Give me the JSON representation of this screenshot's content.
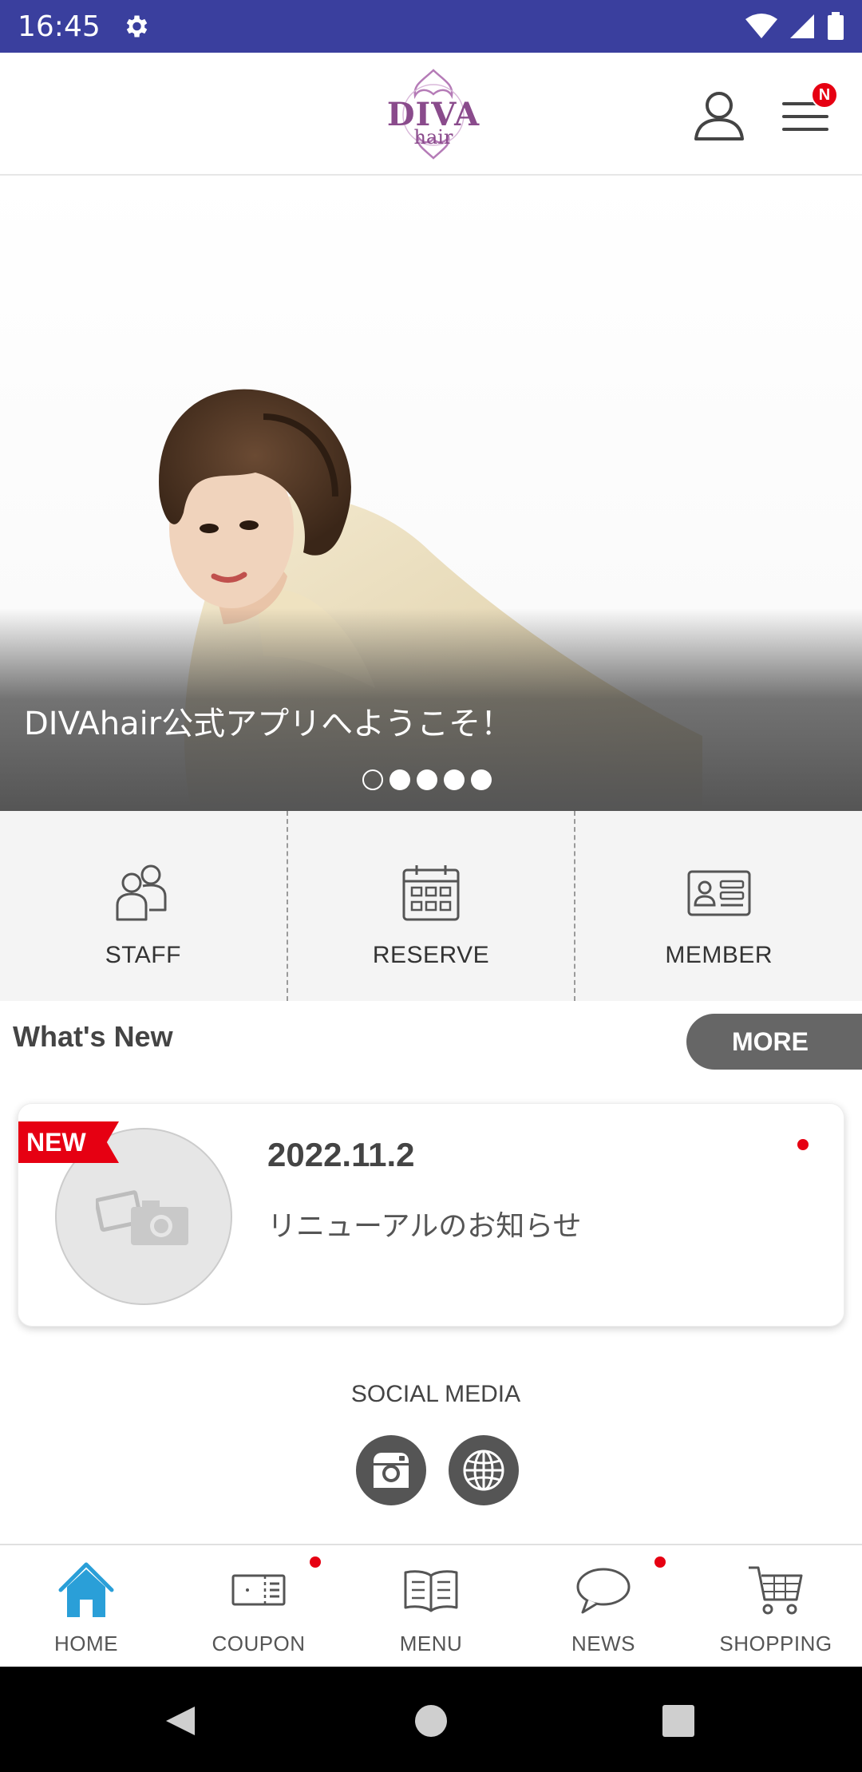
{
  "status_bar": {
    "time": "16:45"
  },
  "header": {
    "logo_text": "DIVA",
    "logo_sub": "hair",
    "menu_badge": "N",
    "brand_color": "#8a4b8c"
  },
  "hero": {
    "caption": "DIVAhair公式アプリへようこそ！",
    "slide_count": 5,
    "active_slide": 0
  },
  "quick_nav": {
    "items": [
      {
        "label": "STAFF",
        "icon": "people-icon"
      },
      {
        "label": "RESERVE",
        "icon": "calendar-icon"
      },
      {
        "label": "MEMBER",
        "icon": "member-card-icon"
      }
    ]
  },
  "whats_new": {
    "title": "What's New",
    "more_label": "MORE",
    "items": [
      {
        "ribbon": "NEW",
        "date": "2022.11.2",
        "title": "リニューアルのお知らせ",
        "unread": true
      }
    ]
  },
  "social": {
    "title": "SOCIAL MEDIA",
    "links": [
      {
        "icon": "instagram-icon"
      },
      {
        "icon": "globe-icon"
      }
    ]
  },
  "bottom_nav": {
    "items": [
      {
        "label": "HOME",
        "icon": "home-icon",
        "active": true
      },
      {
        "label": "COUPON",
        "icon": "coupon-icon",
        "dot": true
      },
      {
        "label": "MENU",
        "icon": "book-icon"
      },
      {
        "label": "NEWS",
        "icon": "chat-bubble-icon",
        "dot": true
      },
      {
        "label": "SHOPPING",
        "icon": "cart-icon"
      }
    ]
  },
  "colors": {
    "status_bar": "#3a3f9e",
    "accent_red": "#e60012",
    "home_active": "#2a9fd8"
  }
}
